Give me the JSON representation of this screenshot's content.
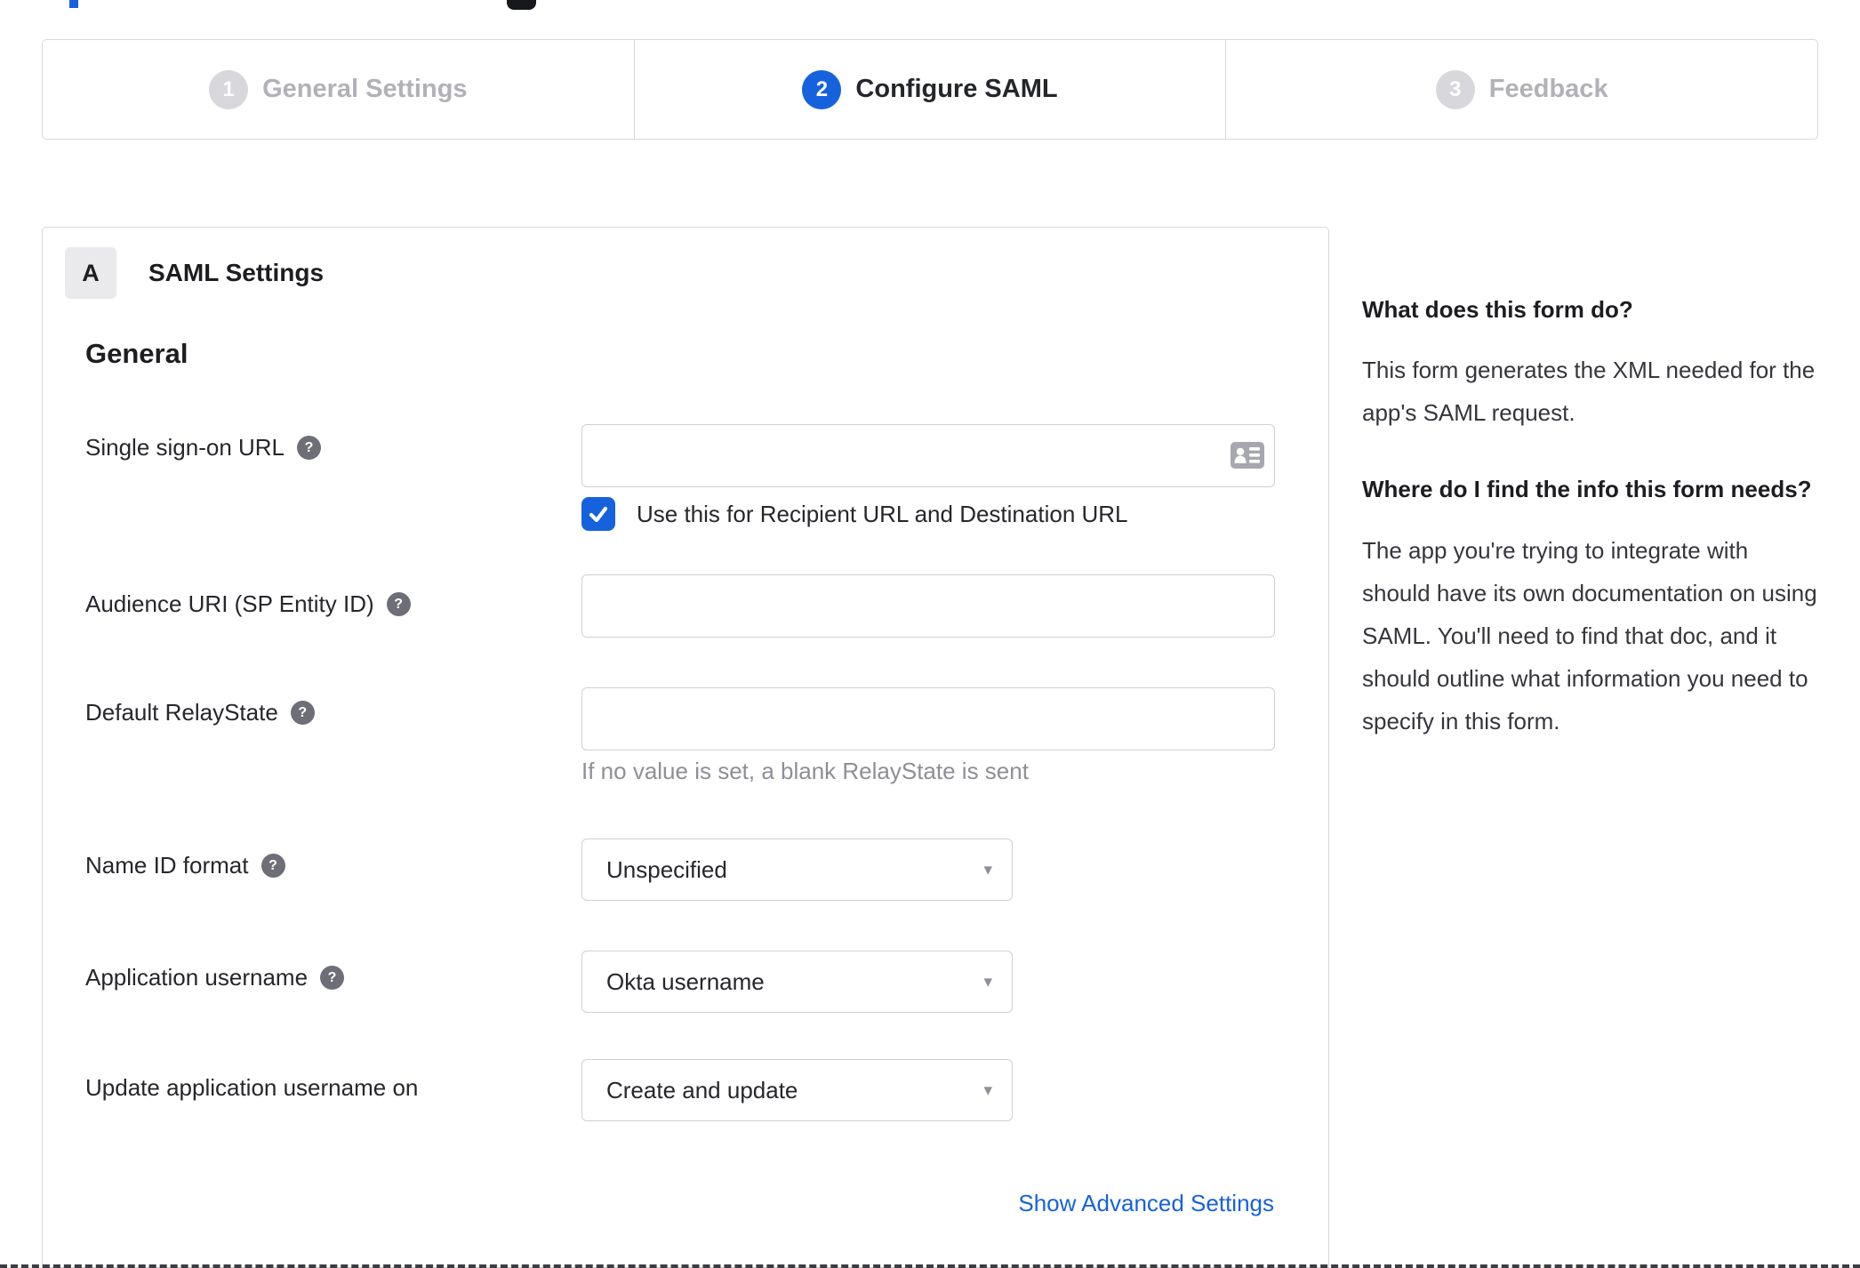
{
  "colors": {
    "accent_blue": "#1662dd",
    "inactive_gray": "#d7d7dc",
    "link_blue": "#1662dd",
    "help_icon_gray": "#6e6e78"
  },
  "stepper": {
    "steps": [
      {
        "number": "1",
        "label": "General Settings",
        "state": "inactive"
      },
      {
        "number": "2",
        "label": "Configure SAML",
        "state": "active"
      },
      {
        "number": "3",
        "label": "Feedback",
        "state": "inactive"
      }
    ]
  },
  "card": {
    "badge": "A",
    "title": "SAML Settings",
    "section_heading": "General",
    "rows": [
      {
        "label": "Single sign-on URL",
        "help": true,
        "control": "input",
        "value": ""
      },
      {
        "label": "Audience URI (SP Entity ID)",
        "help": true,
        "control": "input",
        "value": ""
      },
      {
        "label": "Default RelayState",
        "help": true,
        "control": "input",
        "value": "",
        "helper_text": "If no value is set, a blank RelayState is sent"
      },
      {
        "label": "Name ID format",
        "help": true,
        "control": "select",
        "value": "Unspecified"
      },
      {
        "label": "Application username",
        "help": true,
        "control": "select",
        "value": "Okta username"
      },
      {
        "label": "Update application username on",
        "help": false,
        "control": "select",
        "value": "Create and update"
      }
    ],
    "sso_checkbox": {
      "checked": true,
      "label": "Use this for Recipient URL and Destination URL"
    },
    "advanced_link": "Show Advanced Settings"
  },
  "help_panel": {
    "q1_heading": "What does this form do?",
    "q1_body": "This form generates the XML needed for the app's SAML request.",
    "q2_heading": "Where do I find the info this form needs?",
    "q2_body": "The app you're trying to integrate with should have its own documentation on using SAML. You'll need to find that doc, and it should outline what information you need to specify in this form."
  },
  "icons": {
    "help_glyph": "?",
    "dropdown_arrow": "▾"
  }
}
